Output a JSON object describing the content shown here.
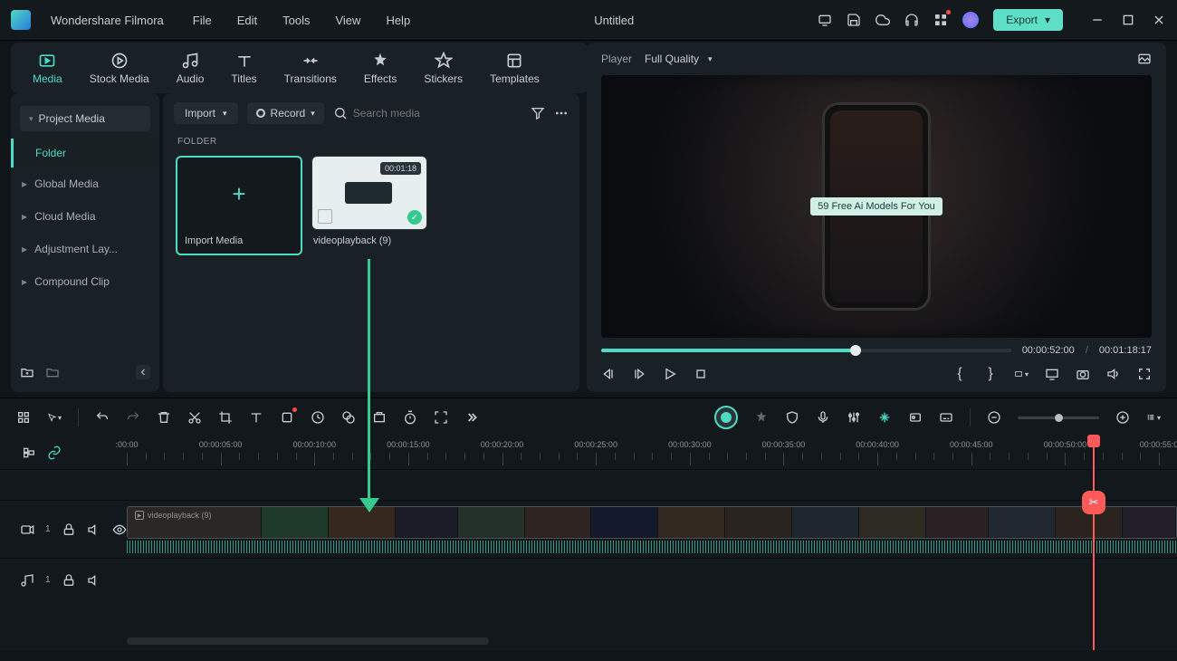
{
  "app": {
    "name": "Wondershare Filmora",
    "title": "Untitled",
    "export": "Export"
  },
  "menu": [
    "File",
    "Edit",
    "Tools",
    "View",
    "Help"
  ],
  "tabs": [
    {
      "id": "media",
      "label": "Media",
      "active": true
    },
    {
      "id": "stock",
      "label": "Stock Media"
    },
    {
      "id": "audio",
      "label": "Audio"
    },
    {
      "id": "titles",
      "label": "Titles"
    },
    {
      "id": "transitions",
      "label": "Transitions"
    },
    {
      "id": "effects",
      "label": "Effects"
    },
    {
      "id": "stickers",
      "label": "Stickers"
    },
    {
      "id": "templates",
      "label": "Templates"
    }
  ],
  "sidebar": {
    "project": "Project Media",
    "folder": "Folder",
    "items": [
      "Global Media",
      "Cloud Media",
      "Adjustment Lay...",
      "Compound Clip"
    ]
  },
  "content": {
    "import_btn": "Import",
    "record_btn": "Record",
    "search_placeholder": "Search media",
    "section": "FOLDER",
    "import_card": "Import Media",
    "video": {
      "name": "videoplayback (9)",
      "duration": "00:01:18"
    }
  },
  "player": {
    "label": "Player",
    "quality": "Full Quality",
    "overlay": "59 Free Ai Models For You",
    "current": "00:00:52:00",
    "total": "00:01:18:17",
    "progress_pct": 62
  },
  "timeline": {
    "marks": [
      ":00:00",
      "00:00:05:00",
      "00:00:10:00",
      "00:00:15:00",
      "00:00:20:00",
      "00:00:25:00",
      "00:00:30:00",
      "00:00:35:00",
      "00:00:40:00",
      "00:00:45:00",
      "00:00:50:00",
      "00:00:55:0"
    ],
    "video_track_index": "1",
    "audio_track_index": "1",
    "clip_name": "videoplayback (9)"
  },
  "colors": {
    "accent": "#4cdbc4"
  }
}
